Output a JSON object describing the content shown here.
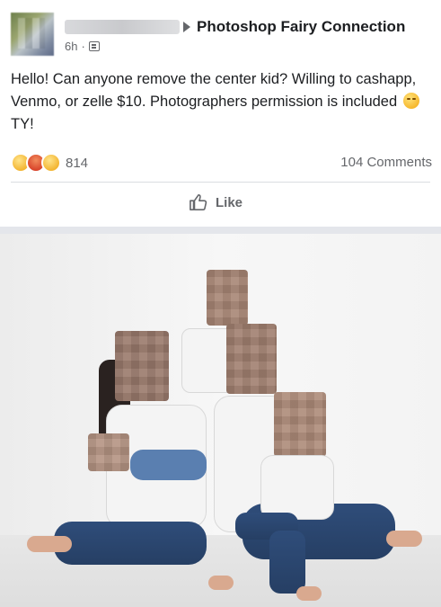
{
  "post": {
    "group_name": "Photoshop Fairy Connection",
    "time": "6h",
    "separator": "·",
    "message_main": "Hello! Can anyone remove the center kid? Willing to cashapp, Venmo, or zelle $10. Photographers permission is included",
    "message_tail": "TY!",
    "reaction_count": "814",
    "comments_label": "104 Comments",
    "like_label": "Like"
  },
  "icons": {
    "privacy": "group-privacy-icon",
    "like": "thumbs-up-icon",
    "reactions": [
      "sad-reaction-icon",
      "angry-reaction-icon",
      "wow-reaction-icon"
    ],
    "inline_emoji": "smiling-face-emoji"
  },
  "colors": {
    "text": "#1c1e21",
    "muted": "#65676b",
    "divider": "#dadde1",
    "band": "#e4e6eb"
  }
}
